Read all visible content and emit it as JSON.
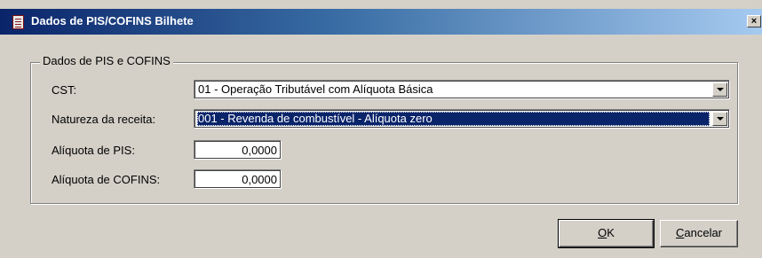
{
  "window": {
    "title": "Dados de PIS/COFINS Bilhete",
    "close_label": "×"
  },
  "group": {
    "legend": "Dados de PIS e COFINS"
  },
  "form": {
    "cst_label": "CST:",
    "cst_value": "01 - Operação Tributável com Alíquota Básica",
    "natureza_label": "Natureza da receita:",
    "natureza_value": "001 - Revenda de combustível - Alíquota zero",
    "aliquota_pis_label": "Alíquota de PIS:",
    "aliquota_pis_value": "0,0000",
    "aliquota_cofins_label": "Alíquota de COFINS:",
    "aliquota_cofins_value": "0,0000"
  },
  "buttons": {
    "ok_mnemonic": "O",
    "ok_rest": "K",
    "cancel_mnemonic": "C",
    "cancel_rest": "ancelar"
  }
}
